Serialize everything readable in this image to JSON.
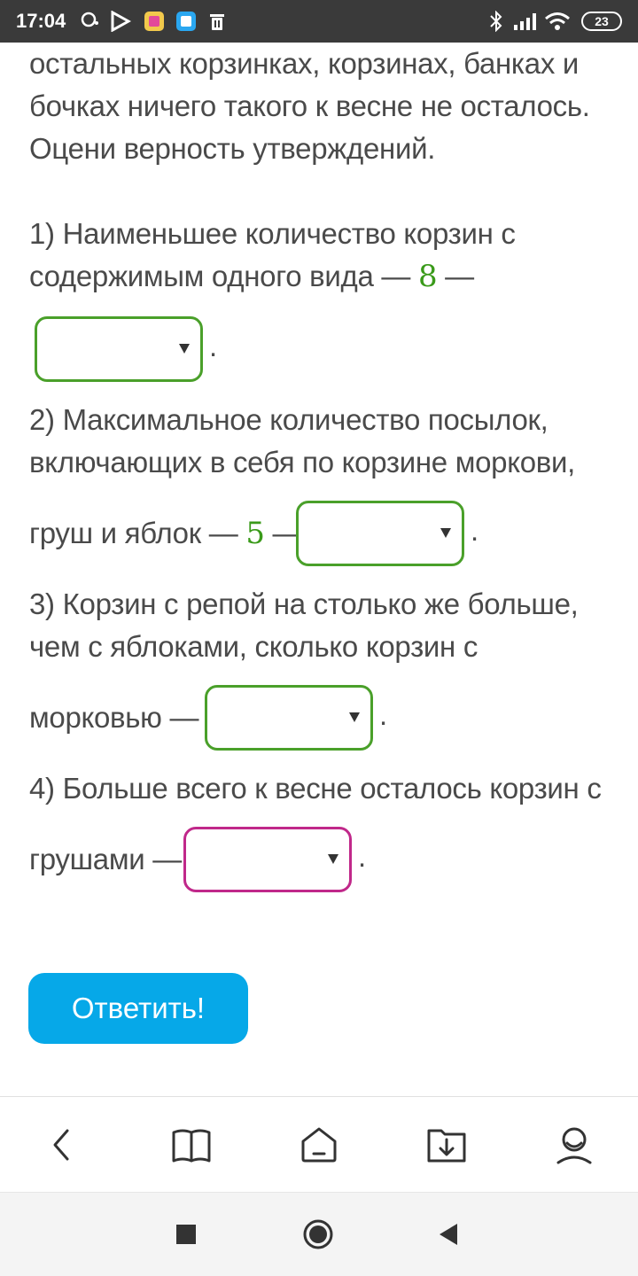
{
  "status_bar": {
    "time": "17:04",
    "battery": "23"
  },
  "question": {
    "intro_lines": [
      "остальных корзинках, корзинах, банках и",
      "бочках ничего такого к весне не осталось.",
      "Оцени верность утверждений."
    ],
    "items": [
      {
        "lines": [
          "1) Наименьшее количество корзин с",
          "содержимым одного вида —"
        ],
        "number": "8",
        "dash": "—"
      },
      {
        "lines": [
          "2) Максимальное количество посылок,",
          "включающих в себя по корзине моркови,"
        ],
        "tail": "груш и яблок —",
        "number": "5",
        "dash": "—"
      },
      {
        "lines": [
          "3) Корзин с репой на столько же больше,",
          "чем с яблоками, сколько корзин с"
        ],
        "tail": "морковью —"
      },
      {
        "lines": [
          "4) Больше всего к весне осталось корзин с"
        ],
        "tail": "грушами —"
      }
    ],
    "period": "."
  },
  "submit_button": "Ответить!",
  "colors": {
    "accent_green": "#4aa02a",
    "accent_pink": "#c0288a",
    "button_blue": "#06a8e8"
  },
  "bottom_nav": [
    "back-icon",
    "book-icon",
    "home-icon",
    "download-folder-icon",
    "profile-icon"
  ]
}
